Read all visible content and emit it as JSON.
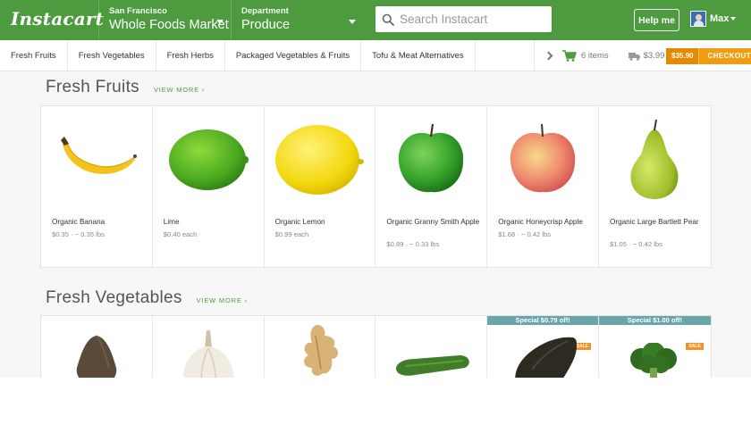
{
  "header": {
    "logo": "Instacart",
    "store": {
      "city": "San Francisco",
      "name": "Whole Foods Market"
    },
    "department": {
      "label": "Department",
      "name": "Produce"
    },
    "search_placeholder": "Search Instacart",
    "help_label": "Help me",
    "user_name": "Max"
  },
  "categories": [
    "Fresh Fruits",
    "Fresh Vegetables",
    "Fresh Herbs",
    "Packaged Vegetables & Fruits",
    "Tofu & Meat Alternatives"
  ],
  "cart": {
    "items_label": "6 items",
    "delivery_fee": "$3.99",
    "total": "$35.90",
    "checkout_label": "CHECKOUT"
  },
  "sections": [
    {
      "title": "Fresh Fruits",
      "view_more": "VIEW MORE ›",
      "products": [
        {
          "name": "Organic Banana",
          "price": "$0.35 · ~ 0.35 lbs",
          "icon": "banana-image"
        },
        {
          "name": "Lime",
          "price": "$0.40 each",
          "icon": "lime-image"
        },
        {
          "name": "Organic Lemon",
          "price": "$0.99 each",
          "icon": "lemon-image"
        },
        {
          "name": "Organic Granny Smith Apple",
          "price": "$0.89 · ~ 0.33 lbs",
          "icon": "green-apple-image"
        },
        {
          "name": "Organic Honeycrisp Apple",
          "price": "$1.68 · ~ 0.42 lbs",
          "icon": "red-apple-image"
        },
        {
          "name": "Organic Large Bartlett Pear",
          "price": "$1.05 · ~ 0.42 lbs",
          "icon": "pear-image"
        }
      ]
    },
    {
      "title": "Fresh Vegetables",
      "view_more": "VIEW MORE ›",
      "products": [
        {
          "icon": "avocado-image"
        },
        {
          "icon": "garlic-image"
        },
        {
          "icon": "ginger-image"
        },
        {
          "icon": "cucumber-image"
        },
        {
          "banner": "Special $0.79 off!",
          "badge": "SALE",
          "icon": "avocado-image"
        },
        {
          "banner": "Special $1.00 off!",
          "badge": "SALE",
          "icon": "broccoli-image"
        }
      ]
    }
  ],
  "colors": {
    "brand_green": "#4e9a3f",
    "checkout_orange": "#f09d13",
    "special_banner": "#6aa5a9",
    "sale_badge": "#f39325"
  }
}
